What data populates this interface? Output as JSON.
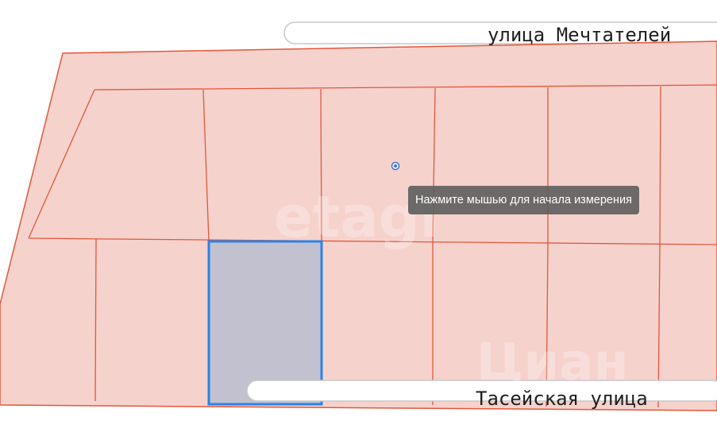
{
  "map": {
    "streets": [
      {
        "name": "улица Мечтателей"
      },
      {
        "name": "Тасейская улица"
      }
    ],
    "watermarks": [
      "etagi",
      "Циан"
    ],
    "measure_tooltip": "Нажмите мышью для начала измерения",
    "colors": {
      "parcel_fill": "#f6d2cd",
      "parcel_border": "#e2573a",
      "selected_fill": "#c1c1cf",
      "selected_border": "#2a83e6",
      "cursor_marker": "#3b6fd4",
      "road": "#ffffff"
    }
  }
}
